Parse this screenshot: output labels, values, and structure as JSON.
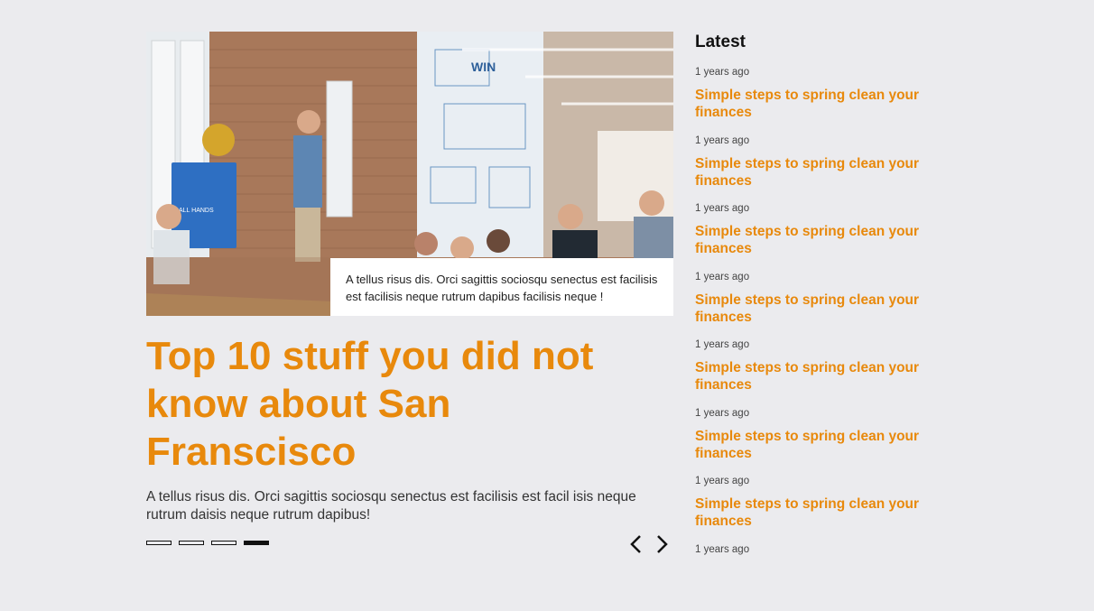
{
  "feature": {
    "image_alt": "Team meeting presentation in a brick-walled office",
    "whiteboard_text": "WIN",
    "screen_text": "ALL HANDS",
    "caption": "A tellus risus dis. Orci sagittis sociosqu senectus est facilisis est facilisis neque rutrum dapibus facilisis neque !",
    "headline": "Top 10 stuff you did not know about San Franscisco",
    "excerpt": "A tellus risus dis. Orci sagittis sociosqu senectus est facilisis est facil isis neque rutrum daisis neque rutrum dapibus!",
    "pager": {
      "count": 4,
      "active_index": 3
    },
    "accent_color": "#e8890c"
  },
  "sidebar": {
    "title": "Latest",
    "items": [
      {
        "meta": "1 years ago",
        "title": "Simple steps to spring clean your finances"
      },
      {
        "meta": "1 years ago",
        "title": "Simple steps to spring clean your finances"
      },
      {
        "meta": "1 years ago",
        "title": "Simple steps to spring clean your finances"
      },
      {
        "meta": "1 years ago",
        "title": "Simple steps to spring clean your finances"
      },
      {
        "meta": "1 years ago",
        "title": "Simple steps to spring clean your finances"
      },
      {
        "meta": "1 years ago",
        "title": "Simple steps to spring clean your finances"
      },
      {
        "meta": "1 years ago",
        "title": "Simple steps to spring clean your finances"
      },
      {
        "meta": "1 years ago",
        "title": ""
      }
    ]
  },
  "icons": {
    "prev": "chevron-left-icon",
    "next": "chevron-right-icon"
  }
}
